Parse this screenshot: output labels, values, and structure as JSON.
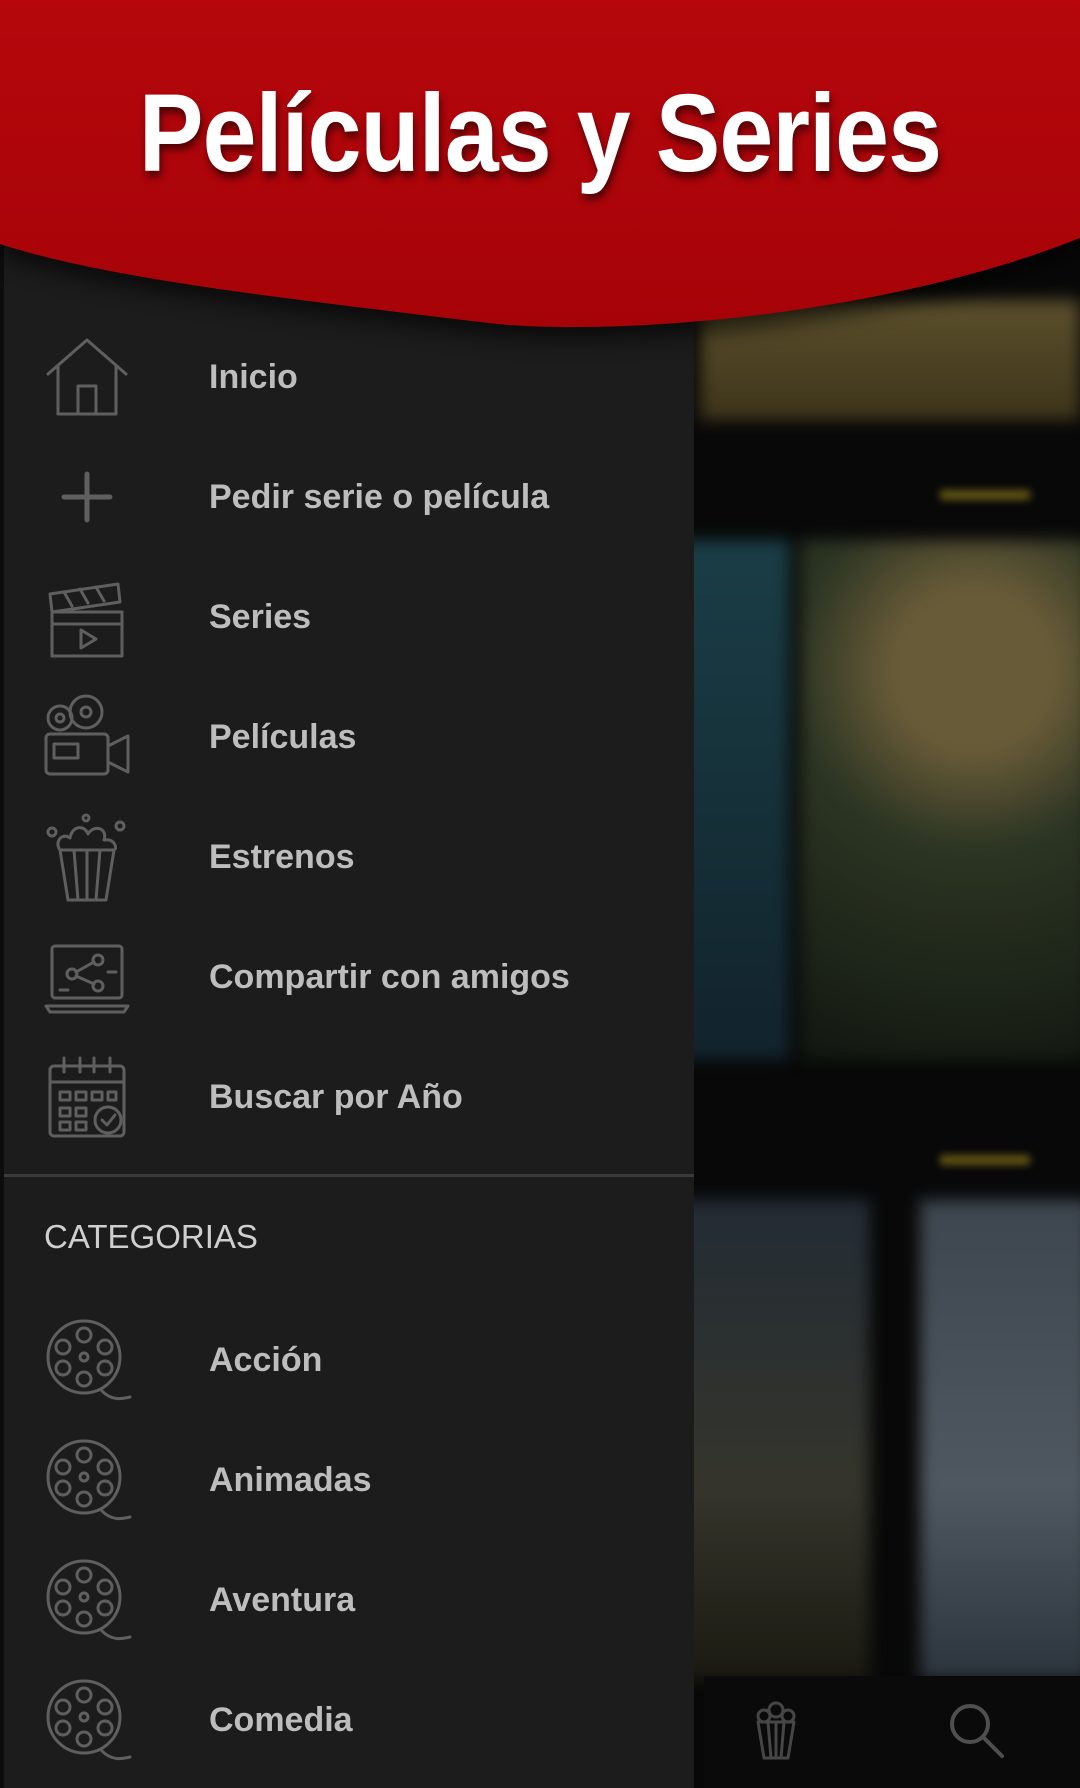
{
  "header": {
    "title": "Películas y Series"
  },
  "menu": [
    {
      "label": "Inicio",
      "icon": "home-icon"
    },
    {
      "label": "Pedir serie o película",
      "icon": "plus-icon"
    },
    {
      "label": "Series",
      "icon": "clapperboard-icon"
    },
    {
      "label": "Películas",
      "icon": "movie-camera-icon"
    },
    {
      "label": "Estrenos",
      "icon": "popcorn-icon"
    },
    {
      "label": "Compartir con amigos",
      "icon": "share-laptop-icon"
    },
    {
      "label": "Buscar por Año",
      "icon": "calendar-icon"
    }
  ],
  "categories": {
    "title": "CATEGORIAS",
    "items": [
      {
        "label": "Acción",
        "icon": "film-reel-icon"
      },
      {
        "label": "Animadas",
        "icon": "film-reel-icon"
      },
      {
        "label": "Aventura",
        "icon": "film-reel-icon"
      },
      {
        "label": "Comedia",
        "icon": "film-reel-icon"
      }
    ]
  },
  "bottom_nav": [
    {
      "icon": "popcorn-icon"
    },
    {
      "icon": "search-icon"
    }
  ],
  "colors": {
    "header_red": "#b5070c",
    "drawer_bg": "#1c1c1c",
    "label_gray": "#bdbdbd"
  }
}
